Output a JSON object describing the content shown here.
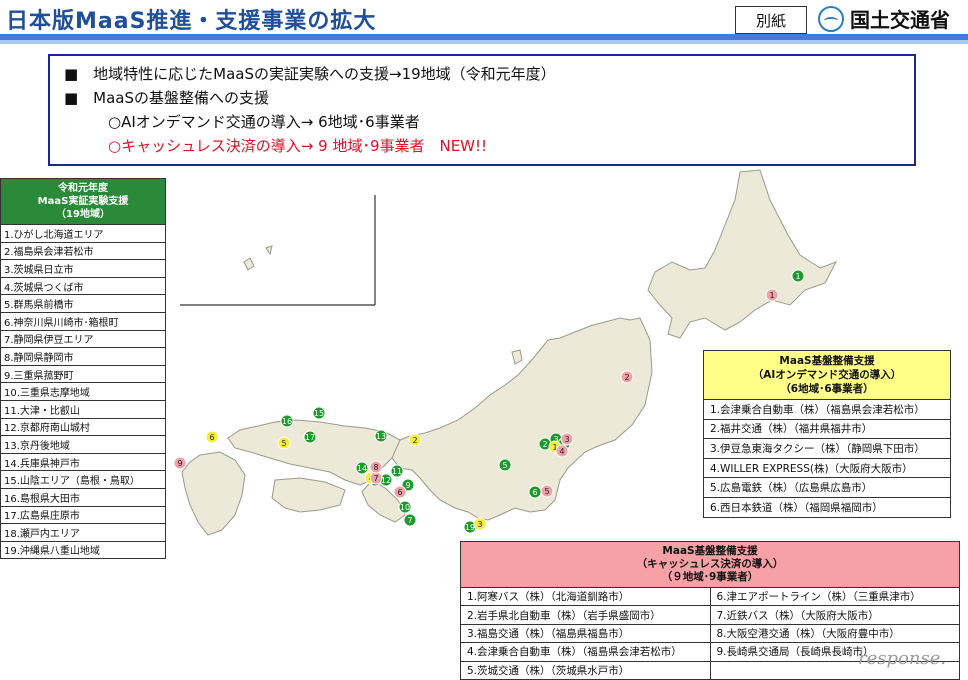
{
  "header": {
    "title": "日本版MaaS推進・支援事業の拡大",
    "badge": "別紙",
    "ministry": "国土交通省"
  },
  "summary": {
    "line1": "■　地域特性に応じたMaaSの実証実験への支援→19地域（令和元年度）",
    "line2": "■　MaaSの基盤整備への支援",
    "line3": "○AIオンデマンド交通の導入→ 6地域･6事業者",
    "line4": "○キャッシュレス決済の導入→  9 地域･9事業者　NEW!!"
  },
  "left_table": {
    "header": [
      "令和元年度",
      "MaaS実証実験支援",
      "（19地域）"
    ],
    "rows": [
      "1.ひがし北海道エリア",
      "2.福島県会津若松市",
      "3.茨城県日立市",
      "4.茨城県つくば市",
      "5.群馬県前橋市",
      "6.神奈川県川崎市･箱根町",
      "7.静岡県伊豆エリア",
      "8.静岡県静岡市",
      "9.三重県菰野町",
      "10.三重県志摩地域",
      "11.大津・比叡山",
      "12.京都府南山城村",
      "13.京丹後地域",
      "14.兵庫県神戸市",
      "15.山陰エリア（島根・鳥取）",
      "16.島根県大田市",
      "17.広島県庄原市",
      "18.瀬戸内エリア",
      "19.沖縄県八重山地域"
    ]
  },
  "ai_table": {
    "header": [
      "MaaS基盤整備支援",
      "（AIオンデマンド交通の導入）",
      "（6地域･6事業者）"
    ],
    "rows": [
      "1.会津乗合自動車（株）（福島県会津若松市）",
      "2.福井交通（株）（福井県福井市）",
      "3.伊豆急東海タクシー（株）（静岡県下田市）",
      "4.WILLER EXPRESS(株)（大阪府大阪市）",
      "5.広島電鉄（株）（広島県広島市）",
      "6.西日本鉄道（株）（福岡県福岡市）"
    ]
  },
  "cash_table": {
    "header": [
      "MaaS基盤整備支援",
      "（キャッシュレス決済の導入）",
      "（９地域･9事業者）"
    ],
    "rows": [
      [
        "1.阿寒バス（株）（北海道釧路市）",
        "6.津エアポートライン（株）（三重県津市）"
      ],
      [
        "2.岩手県北自動車（株）（岩手県盛岡市）",
        "7.近鉄バス（株）（大阪府大阪市）"
      ],
      [
        "3.福島交通（株）（福島県福島市）",
        "8.大阪空港交通（株）（大阪府豊中市）"
      ],
      [
        "4.会津乗合自動車（株）（福島県会津若松市）",
        "9.長崎県交通局（長崎県長崎市）"
      ],
      [
        "5.茨城交通（株）（茨城県水戸市）",
        ""
      ]
    ]
  },
  "map_markers": {
    "green": [
      "1",
      "2",
      "3",
      "4",
      "5",
      "6",
      "7",
      "8",
      "9",
      "10",
      "11",
      "12",
      "13",
      "14",
      "15",
      "16",
      "17",
      "19"
    ],
    "yellow": [
      "1",
      "2",
      "3",
      "4",
      "5",
      "6"
    ],
    "red": [
      "1",
      "2",
      "3",
      "4",
      "5",
      "6",
      "7",
      "8",
      "9"
    ]
  },
  "colors": {
    "green": "#1e9a2c",
    "yellow": "#f4ee3a",
    "red": "#f2a0a8",
    "title": "#1f4e9c"
  },
  "watermark": "response."
}
